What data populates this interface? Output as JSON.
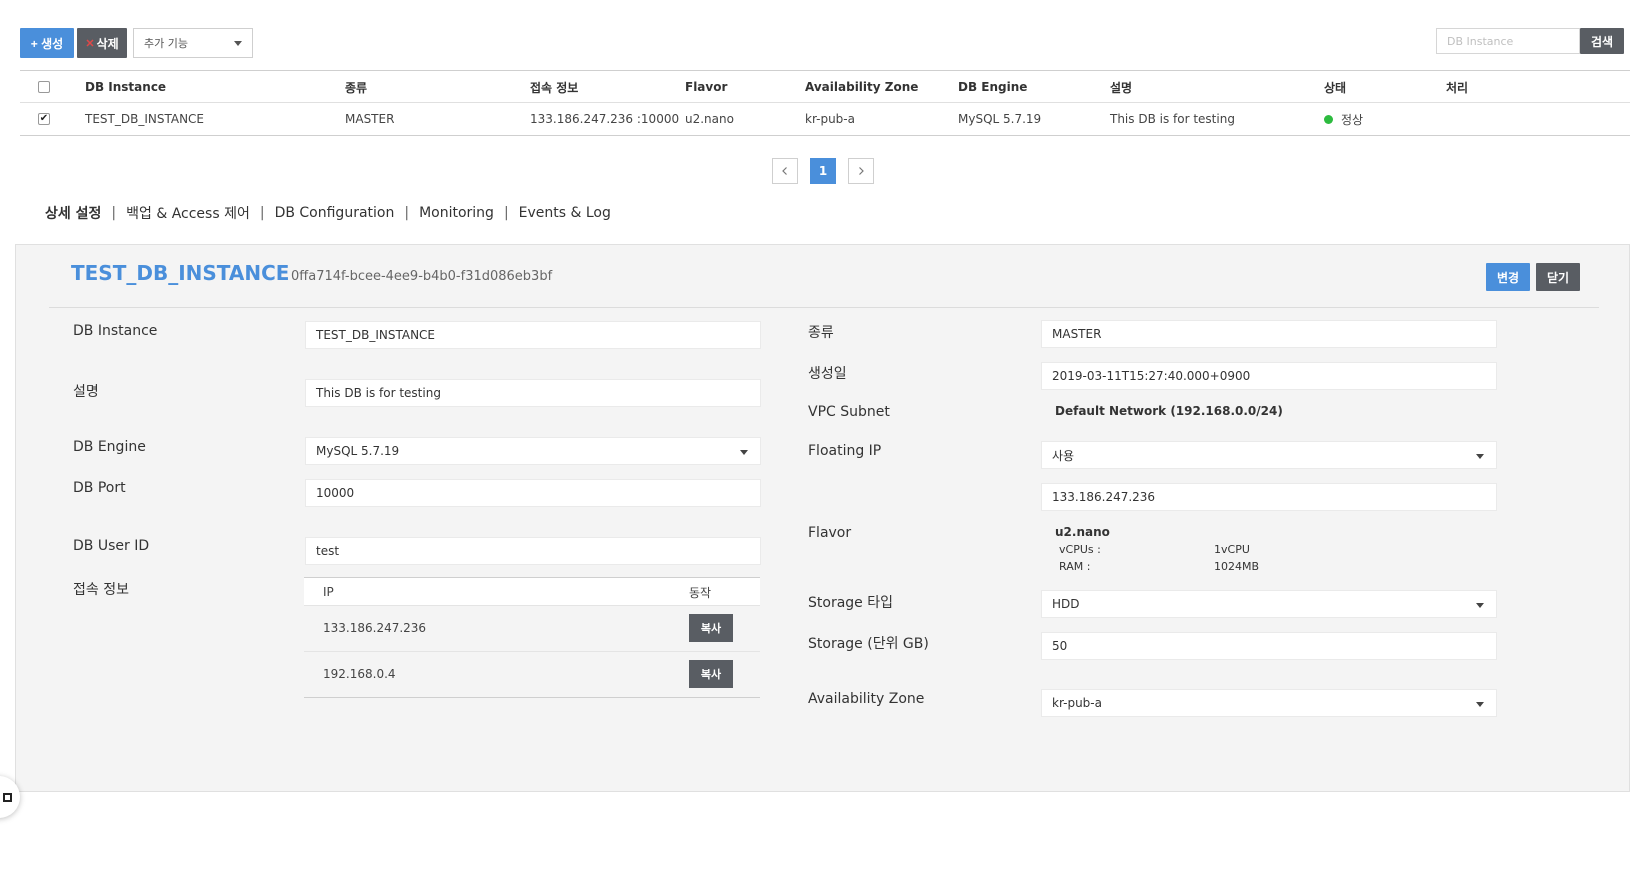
{
  "toolbar": {
    "create_label": "+ 생성",
    "delete_label": "삭제",
    "delete_icon": "x-icon",
    "extra_label": "추가 기능",
    "search_placeholder": "DB Instance",
    "search_label": "검색"
  },
  "table": {
    "columns": [
      "DB Instance",
      "종류",
      "접속 정보",
      "Flavor",
      "Availability Zone",
      "DB Engine",
      "설명",
      "상태",
      "처리"
    ],
    "rows": [
      {
        "checked": true,
        "instance": "TEST_DB_INSTANCE",
        "type": "MASTER",
        "conn": "133.186.247.236 :10000",
        "flavor": "u2.nano",
        "az": "kr-pub-a",
        "engine": "MySQL 5.7.19",
        "desc": "This DB is for testing",
        "status": "정상",
        "status_color": "#2dbb3f",
        "action": ""
      }
    ]
  },
  "pager": {
    "current": "1",
    "prev_icon": "chevron-left-icon",
    "next_icon": "chevron-right-icon"
  },
  "tabs": [
    {
      "label": "상세 설정",
      "active": true
    },
    {
      "label": "백업 & Access 제어"
    },
    {
      "label": "DB Configuration"
    },
    {
      "label": "Monitoring"
    },
    {
      "label": "Events & Log"
    }
  ],
  "detail": {
    "title": "TEST_DB_INSTANCE",
    "uuid": "0ffa714f-bcee-4ee9-b4b0-f31d086eb3bf",
    "change_label": "변경",
    "close_label": "닫기",
    "left": {
      "instance_label": "DB Instance",
      "instance_value": "TEST_DB_INSTANCE",
      "desc_label": "설명",
      "desc_value": "This DB is for testing",
      "engine_label": "DB Engine",
      "engine_value": "MySQL 5.7.19",
      "port_label": "DB Port",
      "port_value": "10000",
      "user_label": "DB User ID",
      "user_value": "test",
      "conn_label": "접속 정보",
      "conn_col_ip": "IP",
      "conn_col_action": "동작",
      "conn_rows": [
        {
          "ip": "133.186.247.236",
          "copy": "복사"
        },
        {
          "ip": "192.168.0.4",
          "copy": "복사"
        }
      ]
    },
    "right": {
      "type_label": "종류",
      "type_value": "MASTER",
      "created_label": "생성일",
      "created_value": "2019-03-11T15:27:40.000+0900",
      "vpc_label": "VPC Subnet",
      "vpc_value": "Default Network (192.168.0.0/24)",
      "fip_label": "Floating IP",
      "fip_value": "사용",
      "fip_ip": "133.186.247.236",
      "flavor_label": "Flavor",
      "flavor_name": "u2.nano",
      "vcpu_key": "vCPUs :",
      "vcpu_value": "1vCPU",
      "ram_key": "RAM :",
      "ram_value": "1024MB",
      "storage_type_label": "Storage 타입",
      "storage_type_value": "HDD",
      "storage_size_label": "Storage (단위 GB)",
      "storage_size_value": "50",
      "az_label": "Availability Zone",
      "az_value": "kr-pub-a"
    }
  }
}
